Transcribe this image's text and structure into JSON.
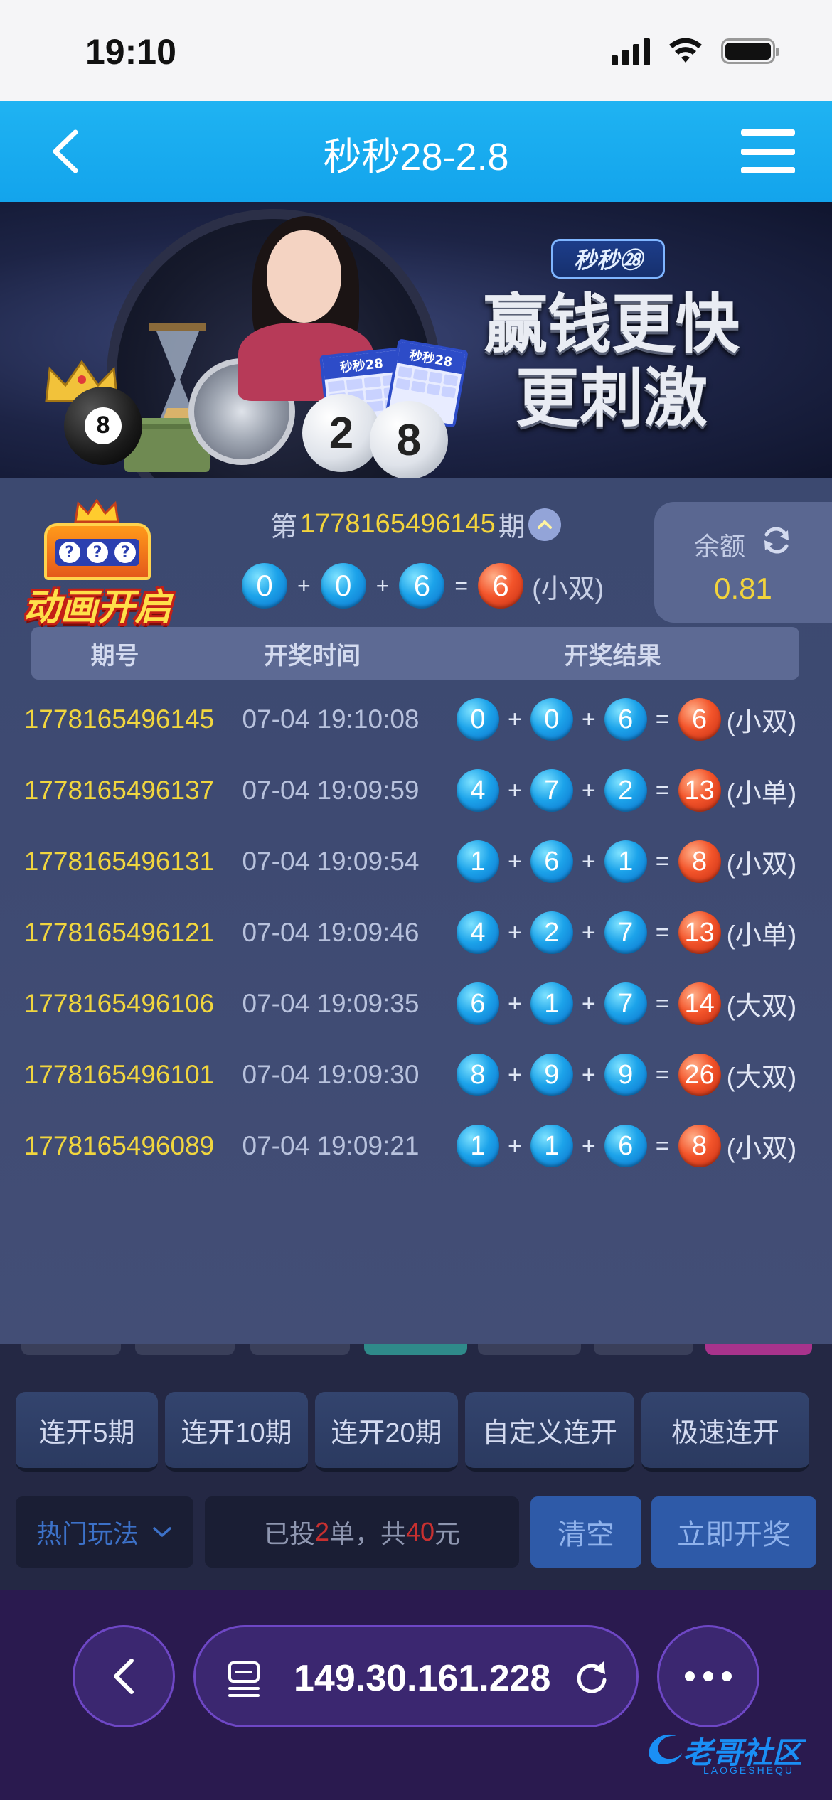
{
  "status_bar": {
    "time": "19:10"
  },
  "header": {
    "title": "秒秒28-2.8"
  },
  "banner": {
    "badge": "秒秒㉘",
    "slogan_line1": "赢钱更快",
    "slogan_line2": "更刺激",
    "ticket_label": "秒秒28"
  },
  "animation_logo": {
    "text": "动画开启",
    "reel_symbols": [
      "?",
      "?",
      "?"
    ]
  },
  "current_draw": {
    "prefix": "第",
    "period": "1778165496145",
    "suffix": "期",
    "balls": [
      "0",
      "0",
      "6"
    ],
    "sum": "6",
    "tag": "(小双)",
    "plus": "+",
    "equals": "="
  },
  "balance": {
    "label": "余额",
    "value": "0.81"
  },
  "table": {
    "headers": [
      "期号",
      "开奖时间",
      "开奖结果"
    ],
    "rows": [
      {
        "period": "1778165496145",
        "time": "07-04 19:10:08",
        "balls": [
          "0",
          "0",
          "6"
        ],
        "sum": "6",
        "tag": "(小双)"
      },
      {
        "period": "1778165496137",
        "time": "07-04 19:09:59",
        "balls": [
          "4",
          "7",
          "2"
        ],
        "sum": "13",
        "tag": "(小单)"
      },
      {
        "period": "1778165496131",
        "time": "07-04 19:09:54",
        "balls": [
          "1",
          "6",
          "1"
        ],
        "sum": "8",
        "tag": "(小双)"
      },
      {
        "period": "1778165496121",
        "time": "07-04 19:09:46",
        "balls": [
          "4",
          "2",
          "7"
        ],
        "sum": "13",
        "tag": "(小单)"
      },
      {
        "period": "1778165496106",
        "time": "07-04 19:09:35",
        "balls": [
          "6",
          "1",
          "7"
        ],
        "sum": "14",
        "tag": "(大双)"
      },
      {
        "period": "1778165496101",
        "time": "07-04 19:09:30",
        "balls": [
          "8",
          "9",
          "9"
        ],
        "sum": "26",
        "tag": "(大双)"
      },
      {
        "period": "1778165496089",
        "time": "07-04 19:09:21",
        "balls": [
          "1",
          "1",
          "6"
        ],
        "sum": "8",
        "tag": "(小双)"
      }
    ]
  },
  "modes": [
    "连开5期",
    "连开10期",
    "连开20期",
    "自定义连开",
    "极速连开"
  ],
  "controls": {
    "hot_label": "热门玩法",
    "bet_prefix": "已投",
    "bet_count": "2",
    "bet_mid": "单，共",
    "bet_amount": "40",
    "bet_suffix": "元",
    "clear_label": "清空",
    "draw_label": "立即开奖"
  },
  "browser": {
    "url": "149.30.161.228"
  },
  "watermark": {
    "text": "老哥社区",
    "sub": "LAOGESHEQU"
  },
  "colors": {
    "header_blue": "#1fb3f2",
    "period_yellow": "#f3d43c",
    "ball_blue": "#1ca3ea",
    "ball_red": "#f3542a",
    "browser_purple": "#2a1a4f"
  }
}
